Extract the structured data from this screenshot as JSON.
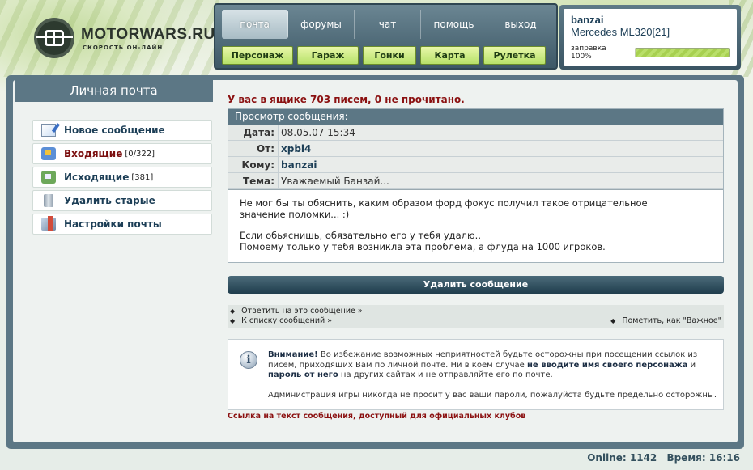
{
  "logo": {
    "title": "MOTORWARS.RU",
    "subtitle": "СКОРОСТЬ ОН-ЛАЙН"
  },
  "nav": {
    "tabs": [
      "почта",
      "форумы",
      "чат",
      "помощь",
      "выход"
    ],
    "subtabs": [
      "Персонаж",
      "Гараж",
      "Гонки",
      "Карта",
      "Рулетка"
    ]
  },
  "user": {
    "name": "banzai",
    "car": "Mercedes ML320[21]",
    "fuel_label": "заправка 100%",
    "fuel_percent": 100
  },
  "sidebar": {
    "title": "Личная почта",
    "items": [
      {
        "label": "Новое сообщение",
        "icon": "new-message-icon",
        "count": ""
      },
      {
        "label": "Входящие",
        "icon": "inbox-icon",
        "count": "[0/322]"
      },
      {
        "label": "Исходящие",
        "icon": "outbox-icon",
        "count": "[381]"
      },
      {
        "label": "Удалить старые",
        "icon": "trash-icon",
        "count": ""
      },
      {
        "label": "Настройки почты",
        "icon": "settings-icon",
        "count": ""
      }
    ]
  },
  "main": {
    "headline": "У вас в ящике 703 писем, 0 не прочитано.",
    "view_title": "Просмотр сообщения:",
    "fields": {
      "date_label": "Дата:",
      "date": "08.05.07 15:34",
      "from_label": "От:",
      "from": "xpbl4",
      "to_label": "Кому:",
      "to": "banzai",
      "subject_label": "Тема:",
      "subject": "Уважаемый Банзай..."
    },
    "body": {
      "p1_line1": "Не мог бы ты обяснить, каким образом форд фокус получил такое отрицательное",
      "p1_line2": "значение поломки... :)",
      "p2_line1": "Если обьяснишь, обязательно его у тебя удалю..",
      "p2_line2": "Помоему только у тебя возникла эта проблема, а флуда на 1000 игроков."
    },
    "delete_button": "Удалить сообщение",
    "links": {
      "reply": "Ответить на это сообщение »",
      "back": "К списку сообщений »",
      "important": "Пометить, как \"Важное\""
    },
    "notice": {
      "bold1": "Внимание!",
      "text1": " Во избежание возможных неприятностей будьте осторожны при посещении ссылок из писем, приходящих Вам по личной почте. Ни в коем случае ",
      "bold2": "не вводите имя своего персонажа",
      "text2": " и ",
      "bold3": "пароль от него",
      "text3": " на других сайтах и не отправляйте его по почте.",
      "line2": "Администрация игры никогда не просит у вас ваши пароли, пожалуйста будьте предельно осторожны."
    },
    "club_link": "Ссылка на текст сообщения, доступный для официальных клубов"
  },
  "footer": {
    "online": "Online: 1142",
    "time": "Время: 16:16"
  }
}
